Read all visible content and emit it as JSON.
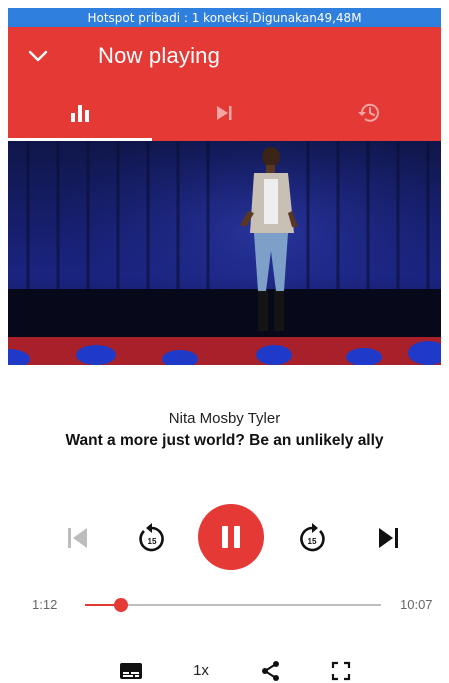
{
  "status_bar": {
    "text": "Hotspot pribadi : 1 koneksi,Digunakan49,48M"
  },
  "app_bar": {
    "title": "Now playing",
    "collapse_icon": "chevron-down-icon"
  },
  "tabs": [
    {
      "icon": "equalizer-icon",
      "active": true
    },
    {
      "icon": "skip-next-icon",
      "active": false
    },
    {
      "icon": "history-icon",
      "active": false
    }
  ],
  "now_playing": {
    "speaker": "Nita Mosby Tyler",
    "title": "Want a more just world? Be an unlikely ally"
  },
  "controls": {
    "previous_icon": "skip-previous-icon",
    "rewind_icon": "replay-15-icon",
    "rewind_seconds": "15",
    "play_pause_icon": "pause-icon",
    "forward_icon": "forward-15-icon",
    "forward_seconds": "15",
    "next_icon": "skip-next-icon"
  },
  "progress": {
    "elapsed": "1:12",
    "duration": "10:07",
    "fraction": 0.12
  },
  "bottom_bar": {
    "subtitles_icon": "subtitles-icon",
    "speed": "1x",
    "share_icon": "share-icon",
    "fullscreen_icon": "fullscreen-icon"
  },
  "colors": {
    "accent": "#e53935",
    "status_bar": "#2f7fdf",
    "icon_dark": "#111111",
    "icon_disabled": "#bdbdbd"
  }
}
